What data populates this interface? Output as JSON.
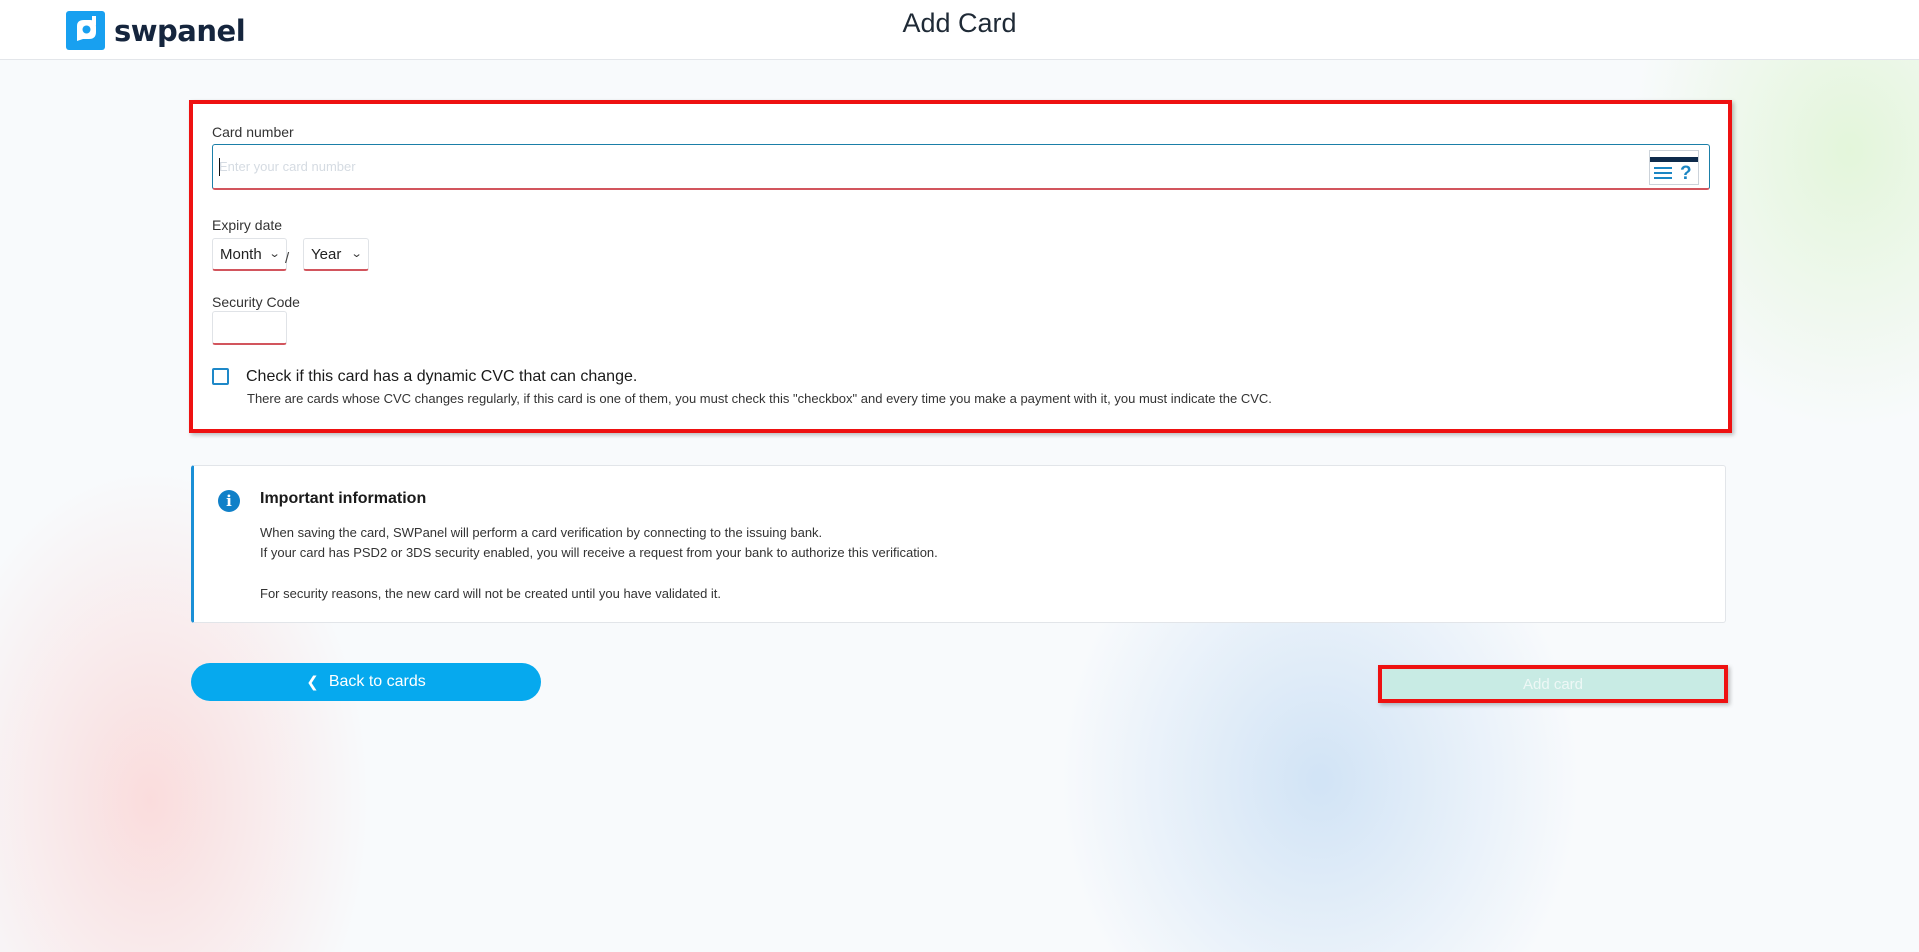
{
  "header": {
    "logo_text": "swpanel",
    "page_title": "Add Card"
  },
  "form": {
    "card_number": {
      "label": "Card number",
      "value": "",
      "placeholder": "Enter your card number",
      "help_icon": "card-cvc-help-icon"
    },
    "expiry": {
      "label": "Expiry date",
      "month": {
        "selected": "Month"
      },
      "separator": "/",
      "year": {
        "selected": "Year"
      }
    },
    "security_code": {
      "label": "Security Code",
      "value": ""
    },
    "dynamic_cvc": {
      "checked": false,
      "label": "Check if this card has a dynamic CVC that can change.",
      "description": "There are cards whose CVC changes regularly, if this card is one of them, you must check this \"checkbox\" and every time you make a payment with it, you must indicate the CVC."
    }
  },
  "info": {
    "icon": "info-icon",
    "title": "Important information",
    "lines": [
      "When saving the card, SWPanel will perform a card verification by connecting to the issuing bank.",
      "If your card has PSD2 or 3DS security enabled, you will receive a request from your bank to authorize this verification.",
      "For security reasons, the new card will not be created until you have validated it."
    ]
  },
  "actions": {
    "back_label": "Back to cards",
    "add_label": "Add card"
  },
  "colors": {
    "brand": "#18a0f0",
    "primary_button": "#06a9ee",
    "disabled_button": "#c8ebe4",
    "highlight_border": "#ee1111",
    "info_accent": "#1a8fd6",
    "error_underline": "#d2555d"
  }
}
